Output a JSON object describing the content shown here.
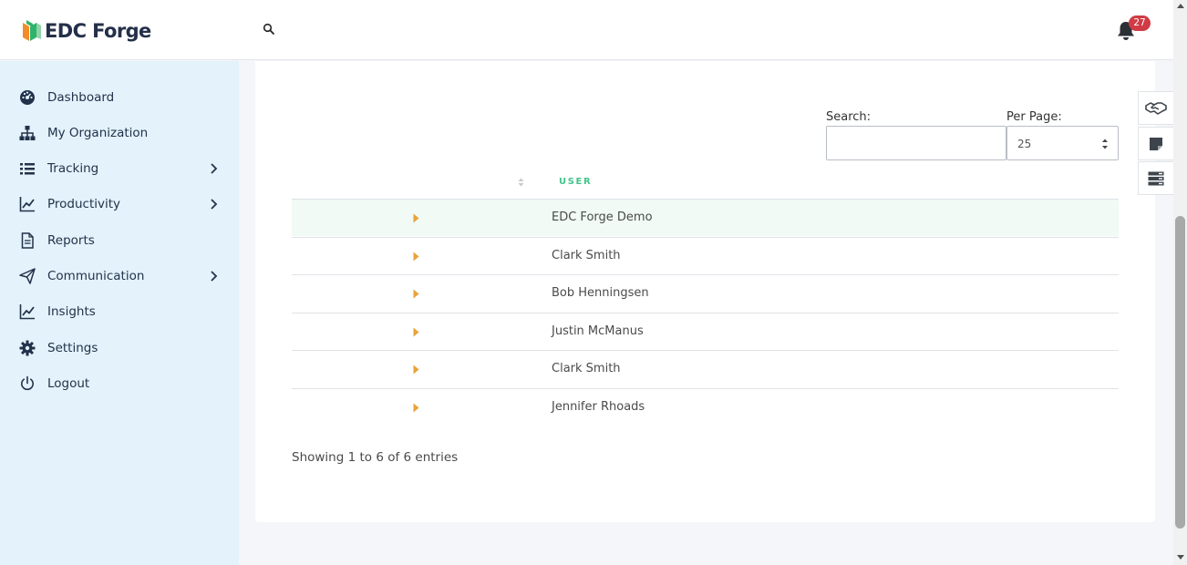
{
  "header": {
    "logo_text": "EDC Forge",
    "search_icon": "search-icon",
    "notification_icon": "bell-icon",
    "notification_count": "27"
  },
  "sidebar": {
    "items": [
      {
        "label": "Dashboard",
        "icon": "dashboard-gauge-icon",
        "has_submenu": false
      },
      {
        "label": "My Organization",
        "icon": "org-chart-icon",
        "has_submenu": false
      },
      {
        "label": "Tracking",
        "icon": "list-icon",
        "has_submenu": true
      },
      {
        "label": "Productivity",
        "icon": "line-chart-icon",
        "has_submenu": true
      },
      {
        "label": "Reports",
        "icon": "document-icon",
        "has_submenu": false
      },
      {
        "label": "Communication",
        "icon": "paper-plane-icon",
        "has_submenu": true
      },
      {
        "label": "Insights",
        "icon": "line-chart-icon",
        "has_submenu": false
      },
      {
        "label": "Settings",
        "icon": "gear-icon",
        "has_submenu": false
      },
      {
        "label": "Logout",
        "icon": "power-icon",
        "has_submenu": false
      }
    ]
  },
  "table_controls": {
    "search_label": "Search:",
    "search_value": "",
    "per_page_label": "Per Page:",
    "per_page_value": "25"
  },
  "table": {
    "columns": [
      "",
      "USER"
    ],
    "rows": [
      {
        "user": "EDC Forge Demo",
        "highlighted": true
      },
      {
        "user": "Clark Smith",
        "highlighted": false
      },
      {
        "user": "Bob Henningsen",
        "highlighted": false
      },
      {
        "user": "Justin McManus",
        "highlighted": false
      },
      {
        "user": "Clark Smith",
        "highlighted": false
      },
      {
        "user": "Jennifer Rhoads",
        "highlighted": false
      }
    ],
    "info": "Showing 1 to 6 of 6 entries"
  },
  "floating_buttons": [
    "handshake-icon",
    "sticky-note-icon",
    "server-icon"
  ],
  "colors": {
    "accent_green": "#43c48a",
    "caret_orange": "#e8a33a",
    "sidebar_bg": "#e3f2fb",
    "badge_red": "#d13b45",
    "nav_text": "#22324a"
  }
}
